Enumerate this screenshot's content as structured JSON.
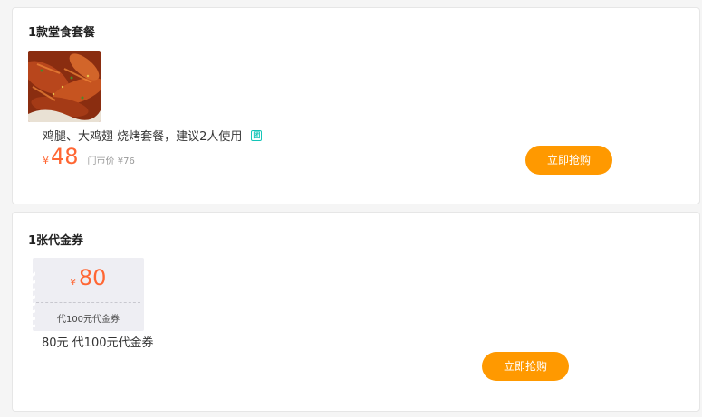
{
  "dine_in_section": {
    "title": "1款堂食套餐",
    "image_icon": "food-photo",
    "description": "鸡腿、大鸡翅 烧烤套餐，建议2人使用",
    "badge": "团",
    "currency_symbol": "¥",
    "price": "48",
    "original_price_label": "门市价 ¥76",
    "buy_label": "立即抢购"
  },
  "voucher_section": {
    "title": "1张代金券",
    "currency_symbol": "¥",
    "price": "80",
    "voucher_label": "代100元代金券",
    "description": "80元 代100元代金券",
    "buy_label": "立即抢购"
  },
  "colors": {
    "accent_orange": "#ff9900",
    "price_orange": "#ff6633",
    "badge_teal": "#14c5b8",
    "voucher_bg": "#eeeef3"
  }
}
